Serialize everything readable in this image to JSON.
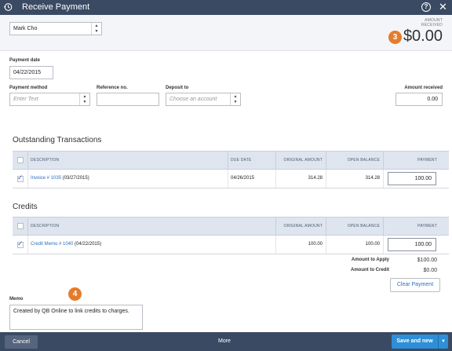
{
  "window": {
    "title": "Receive Payment",
    "help_glyph": "?",
    "close_glyph": "✕"
  },
  "customer": {
    "selected": "Mark Cho"
  },
  "amount_received_header": {
    "label_line1": "AMOUNT",
    "label_line2": "RECEIVED",
    "amount": "$0.00",
    "badge": "3"
  },
  "payment_date": {
    "label": "Payment date",
    "value": "04/22/2015"
  },
  "payment_method": {
    "label": "Payment method",
    "placeholder": "Enter Text"
  },
  "reference_no": {
    "label": "Reference no.",
    "value": ""
  },
  "deposit_to": {
    "label": "Deposit to",
    "placeholder": "Choose an account"
  },
  "amount_received": {
    "label": "Amount received",
    "value": "0.00"
  },
  "outstanding": {
    "title": "Outstanding Transactions",
    "headers": {
      "description": "DESCRIPTION",
      "due_date": "DUE DATE",
      "original_amount": "ORIGINAL AMOUNT",
      "open_balance": "OPEN BALANCE",
      "payment": "PAYMENT"
    },
    "rows": [
      {
        "checked": true,
        "link": "Invoice # 1035",
        "suffix": "(03/27/2015)",
        "due_date": "04/26/2015",
        "original_amount": "314.28",
        "open_balance": "314.28",
        "payment": "100.00"
      }
    ]
  },
  "credits": {
    "title": "Credits",
    "headers": {
      "description": "DESCRIPTION",
      "original_amount": "ORIGINAL AMOUNT",
      "open_balance": "OPEN BALANCE",
      "payment": "PAYMENT"
    },
    "rows": [
      {
        "checked": true,
        "link": "Credit Memo # 1040",
        "suffix": "(04/22/2015)",
        "original_amount": "100.00",
        "open_balance": "100.00",
        "payment": "100.00"
      }
    ]
  },
  "summary": {
    "amount_to_apply_label": "Amount to Apply",
    "amount_to_apply": "$100.00",
    "amount_to_credit_label": "Amount to Credit",
    "amount_to_credit": "$0.00"
  },
  "clear_payment_label": "Clear Payment",
  "memo": {
    "label": "Memo",
    "value": "Created by QB Online to link credits to charges.",
    "badge": "4"
  },
  "footer": {
    "cancel_label": "Cancel",
    "more_label": "More",
    "save_label": "Save and new"
  },
  "colors": {
    "titlebar": "#3b4a63",
    "accent": "#2d8fd7",
    "link": "#2a6fc2",
    "badge": "#e47c2c"
  },
  "icons": {
    "history": "history-clock-icon",
    "help": "help-circle-icon",
    "close": "close-icon",
    "dropdown": "up-down-arrows-icon",
    "checkbox": "checkmark-icon"
  }
}
